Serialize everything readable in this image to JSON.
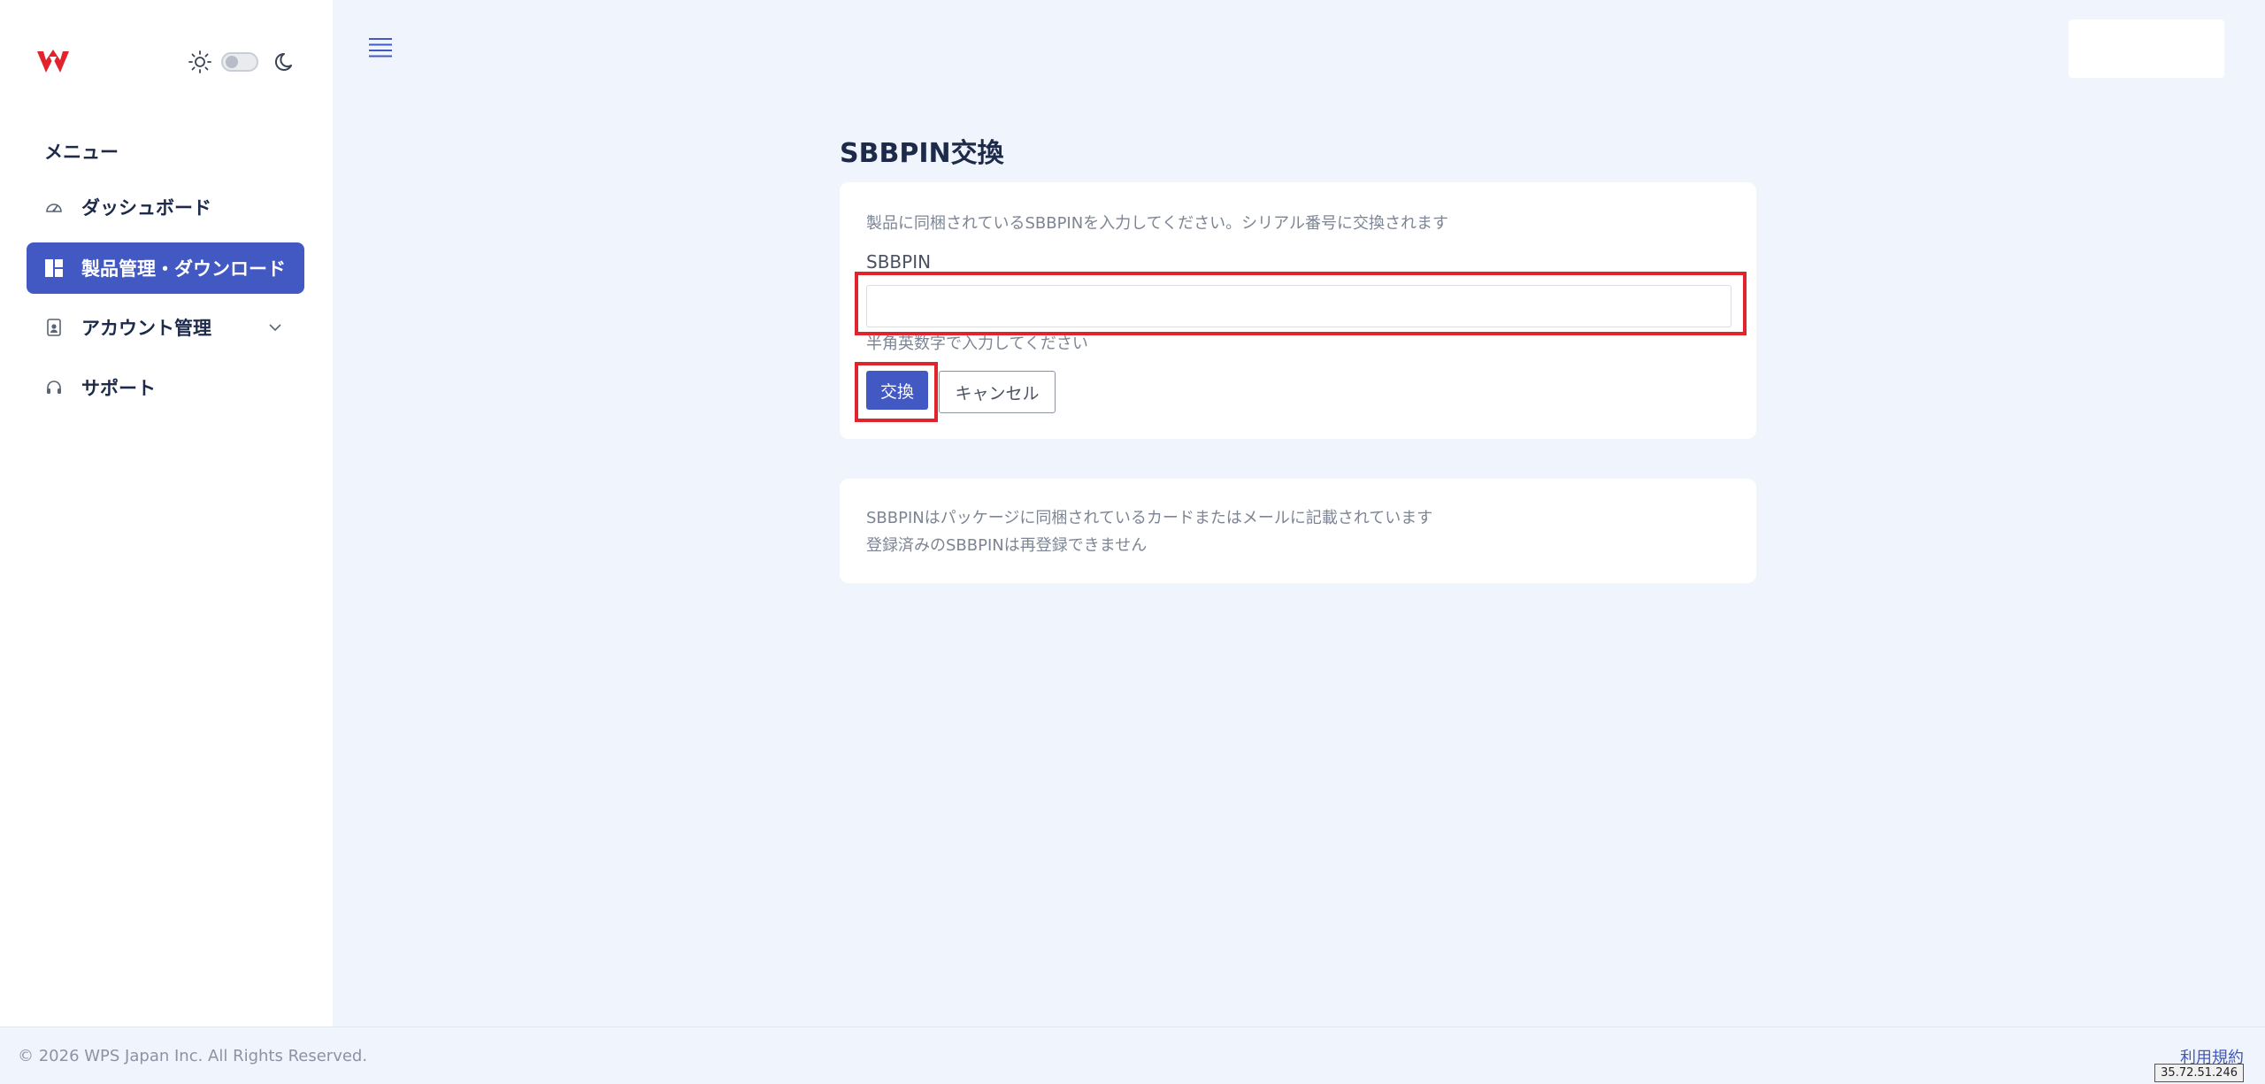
{
  "colors": {
    "accent": "#4258c3",
    "highlight": "#e0232c",
    "background": "#f0f5fd",
    "brand_logo": "#e0232c"
  },
  "sidebar": {
    "logo_icon": "wps-logo-icon",
    "theme_light_icon": "sun-icon",
    "theme_dark_icon": "moon-icon",
    "menu_heading": "メニュー",
    "items": [
      {
        "label": "ダッシュボード",
        "icon": "dashboard-gauge-icon"
      },
      {
        "label": "製品管理・ダウンロード",
        "icon": "grid-layout-icon",
        "active": true
      },
      {
        "label": "アカウント管理",
        "icon": "id-badge-icon",
        "expandable": true
      },
      {
        "label": "サポート",
        "icon": "headset-icon"
      }
    ]
  },
  "header": {
    "menu_icon": "hamburger-icon"
  },
  "main": {
    "title": "SBBPIN交換",
    "form": {
      "description": "製品に同梱されているSBBPINを入力してください。シリアル番号に交換されます",
      "field_label": "SBBPIN",
      "input_value": "",
      "hint": "半角英数字で入力してください",
      "submit_label": "交換",
      "cancel_label": "キャンセル"
    },
    "notes": [
      "SBBPINはパッケージに同梱されているカードまたはメールに記載されています",
      "登録済みのSBBPINは再登録できません"
    ]
  },
  "footer": {
    "copyright": "© 2026 WPS Japan Inc. All Rights Reserved.",
    "terms_label": "利用規約",
    "ip": "35.72.51.246"
  }
}
